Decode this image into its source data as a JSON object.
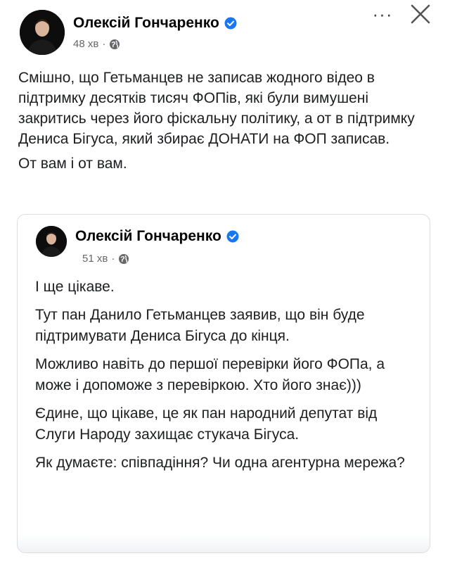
{
  "post": {
    "author": "Олексій Гончаренко",
    "time": "48 хв",
    "separator": "·",
    "more_label": "···",
    "icons": {
      "verified": "verified-badge-icon",
      "audience": "globe-icon",
      "close": "close-icon",
      "more": "more-options-icon"
    },
    "paragraphs": [
      "Смішно, що Гетьманцев не записав жодного відео в підтримку десятків тисяч ФОПів, які були вимушені закритись через його фіскальну політику, а от в підтримку Дениса Бігуса, який збирає ДОНАТИ на ФОП записав.",
      "От вам і от вам."
    ]
  },
  "shared_post": {
    "author": "Олексій Гончаренко",
    "time": "51 хв",
    "separator": "·",
    "paragraphs": [
      "І ще цікаве.",
      "Тут пан Данило Гетьманцев заявив, що він буде підтримувати Дениса Бігуса до кінця.",
      "Можливо навіть до першої перевірки його ФОПа, а може і допоможе з перевіркою. Хто його знає)))",
      "Єдине, що цікаве, це як пан народний депутат від Слуги Народу захищає стукача Бігуса.",
      "Як думаєте: співпадіння? Чи одна агентурна мережа?"
    ]
  },
  "colors": {
    "verified": "#1877f2",
    "meta": "#65676b",
    "text": "#1c1e21",
    "border": "#dadde1"
  }
}
